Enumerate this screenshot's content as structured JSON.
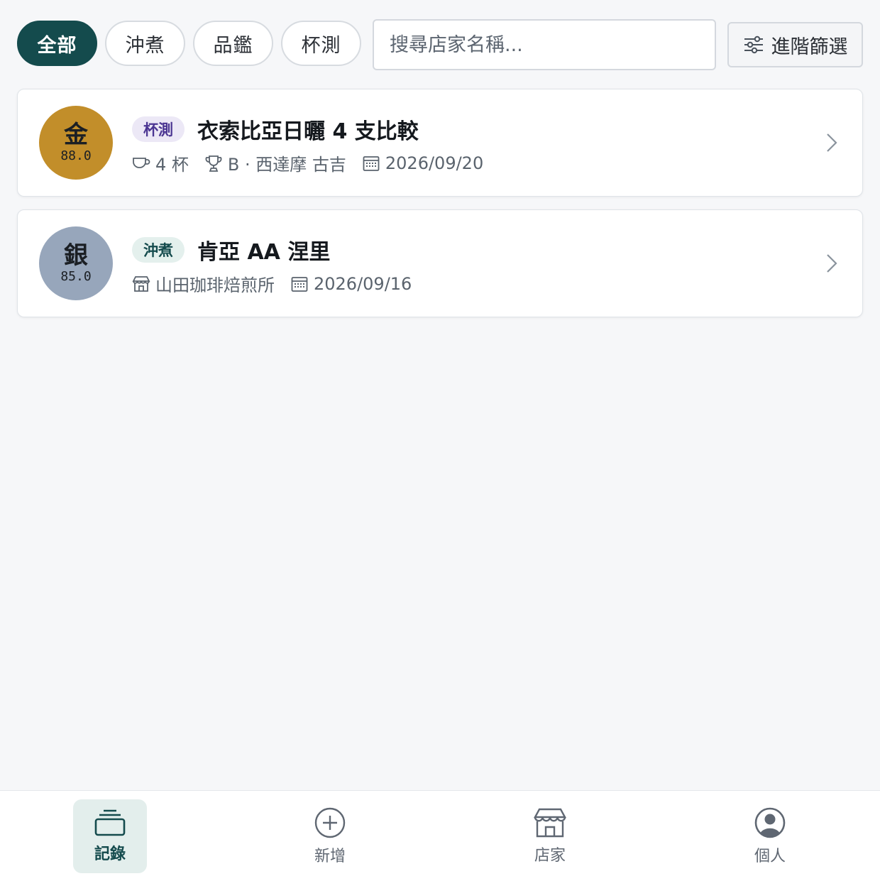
{
  "filters": {
    "all": "全部",
    "brew": "沖煮",
    "tasting": "品鑑",
    "cupping": "杯測"
  },
  "search": {
    "placeholder": "搜尋店家名稱..."
  },
  "advanced_filter_label": "進階篩選",
  "records": [
    {
      "rank": "金",
      "score": "88.0",
      "medal_color": "#c28e2a",
      "tag": "杯測",
      "tag_bg": "#ece8f6",
      "tag_color": "#4b3592",
      "title": "衣索比亞日曬 4 支比較",
      "cups": "4 杯",
      "best": "B · 西達摩 古吉",
      "date": "2026/09/20"
    },
    {
      "rank": "銀",
      "score": "85.0",
      "medal_color": "#97a6bb",
      "tag": "沖煮",
      "tag_bg": "#e4f0ed",
      "tag_color": "#144b4d",
      "title": "肯亞 AA 涅里",
      "shop": "山田珈琲焙煎所",
      "date": "2026/09/16"
    }
  ],
  "nav": {
    "records": "記錄",
    "add": "新增",
    "shops": "店家",
    "profile": "個人"
  },
  "colors": {
    "accent": "#144b4d",
    "background": "#f6f7f9"
  }
}
